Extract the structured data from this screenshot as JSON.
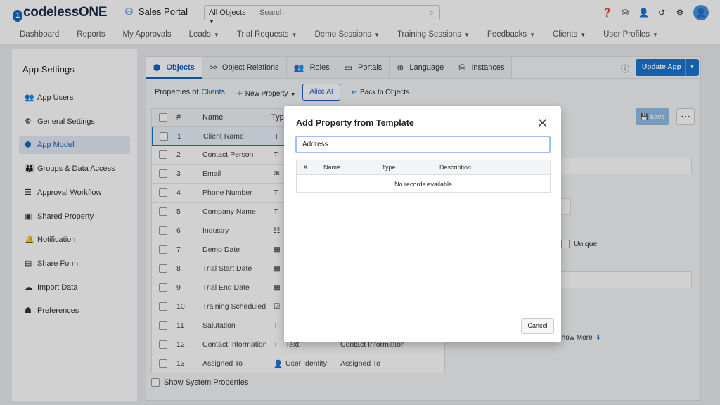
{
  "topbar": {
    "logo_text": "codelessONE",
    "app_name": "Sales Portal",
    "search_scope": "All Objects",
    "search_placeholder": "Search"
  },
  "nav": {
    "items": [
      "Dashboard",
      "Reports",
      "My Approvals",
      "Leads",
      "Trial Requests",
      "Demo Sessions",
      "Training Sessions",
      "Feedbacks",
      "Clients",
      "User Profiles"
    ],
    "has_caret": [
      false,
      false,
      false,
      true,
      true,
      true,
      true,
      true,
      true,
      true
    ]
  },
  "sidebar": {
    "title": "App Settings",
    "items": [
      {
        "label": "App Users",
        "icon": "users-icon"
      },
      {
        "label": "General Settings",
        "icon": "gear-icon"
      },
      {
        "label": "App Model",
        "icon": "cube-icon"
      },
      {
        "label": "Groups & Data Access",
        "icon": "group-icon"
      },
      {
        "label": "Approval Workflow",
        "icon": "checklist-icon"
      },
      {
        "label": "Shared Property",
        "icon": "shared-icon"
      },
      {
        "label": "Notification",
        "icon": "bell-icon"
      },
      {
        "label": "Share Form",
        "icon": "form-icon"
      },
      {
        "label": "Import Data",
        "icon": "cloud-upload-icon"
      },
      {
        "label": "Preferences",
        "icon": "preferences-icon"
      }
    ],
    "active_index": 2
  },
  "tabs": [
    {
      "label": "Objects",
      "icon": "cube-icon"
    },
    {
      "label": "Object Relations",
      "icon": "relations-icon"
    },
    {
      "label": "Roles",
      "icon": "roles-icon"
    },
    {
      "label": "Portals",
      "icon": "portal-icon"
    },
    {
      "label": "Language",
      "icon": "globe-icon"
    },
    {
      "label": "Instances",
      "icon": "database-icon"
    }
  ],
  "toolbar": {
    "update_label": "Update App",
    "props_of_label": "Properties of",
    "object_name": "Clients",
    "new_property_label": "New Property",
    "alice_label": "Alice AI",
    "back_label": "Back to Objects",
    "save_label": "Save"
  },
  "table": {
    "headers": {
      "num": "#",
      "name": "Name",
      "type": "Type"
    },
    "rows": [
      {
        "num": "1",
        "name": "Client Name",
        "type_icon": "T",
        "type": "",
        "label": ""
      },
      {
        "num": "2",
        "name": "Contact Person",
        "type_icon": "T",
        "type": "",
        "label": ""
      },
      {
        "num": "3",
        "name": "Email",
        "type_icon": "✉",
        "type": "",
        "label": ""
      },
      {
        "num": "4",
        "name": "Phone Number",
        "type_icon": "T",
        "type": "",
        "label": ""
      },
      {
        "num": "5",
        "name": "Company Name",
        "type_icon": "T",
        "type": "",
        "label": ""
      },
      {
        "num": "6",
        "name": "Industry",
        "type_icon": "☷",
        "type": "",
        "label": ""
      },
      {
        "num": "7",
        "name": "Demo Date",
        "type_icon": "▦",
        "type": "",
        "label": ""
      },
      {
        "num": "8",
        "name": "Trial Start Date",
        "type_icon": "▦",
        "type": "",
        "label": ""
      },
      {
        "num": "9",
        "name": "Trial End Date",
        "type_icon": "▦",
        "type": "",
        "label": ""
      },
      {
        "num": "10",
        "name": "Training Scheduled",
        "type_icon": "☑",
        "type": "",
        "label": ""
      },
      {
        "num": "11",
        "name": "Salutation",
        "type_icon": "T",
        "type": "",
        "label": ""
      },
      {
        "num": "12",
        "name": "Contact Information",
        "type_icon": "T",
        "type": "Text",
        "label": "Contact Information"
      },
      {
        "num": "13",
        "name": "Assigned To",
        "type_icon": "👤",
        "type": "User Identity",
        "label": "Assigned To"
      }
    ],
    "selected_index": 0,
    "show_system_label": "Show System Properties"
  },
  "right_panel": {
    "unique_label": "Unique",
    "show_more_label": "Show More"
  },
  "modal": {
    "title": "Add Property from Template",
    "search_value": "Address",
    "headers": {
      "num": "#",
      "name": "Name",
      "type": "Type",
      "description": "Description"
    },
    "empty_text": "No records available",
    "cancel_label": "Cancel"
  }
}
